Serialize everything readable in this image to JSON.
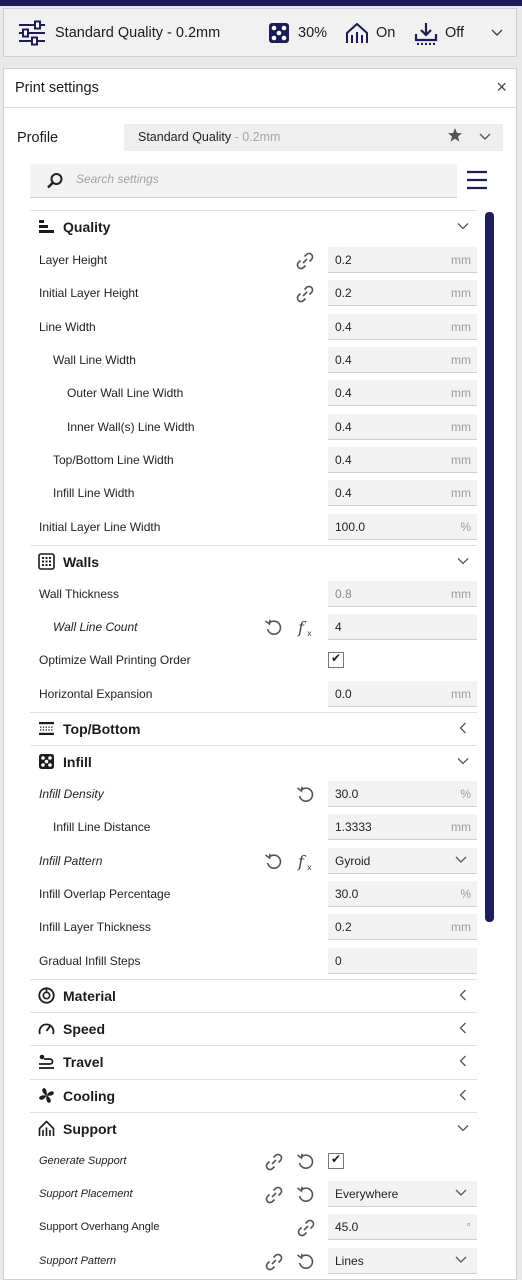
{
  "topbar": {
    "profile_label": "Standard Quality - 0.2mm",
    "infill_value": "30%",
    "support_value": "On",
    "adhesion_value": "Off"
  },
  "panel": {
    "title": "Print settings",
    "close_glyph": "×",
    "profile_label": "Profile",
    "profile_name": "Standard Quality",
    "profile_sub": " - 0.2mm",
    "search_placeholder": "Search settings"
  },
  "sections": {
    "quality": "Quality",
    "walls": "Walls",
    "topbottom": "Top/Bottom",
    "infill": "Infill",
    "material": "Material",
    "speed": "Speed",
    "travel": "Travel",
    "cooling": "Cooling",
    "support": "Support"
  },
  "settings": [
    {
      "label": "Layer Height",
      "value": "0.2",
      "unit": "mm"
    },
    {
      "label": "Initial Layer Height",
      "value": "0.2",
      "unit": "mm"
    },
    {
      "label": "Line Width",
      "value": "0.4",
      "unit": "mm"
    },
    {
      "label": "Wall Line Width",
      "value": "0.4",
      "unit": "mm"
    },
    {
      "label": "Outer Wall Line Width",
      "value": "0.4",
      "unit": "mm"
    },
    {
      "label": "Inner Wall(s) Line Width",
      "value": "0.4",
      "unit": "mm"
    },
    {
      "label": "Top/Bottom Line Width",
      "value": "0.4",
      "unit": "mm"
    },
    {
      "label": "Infill Line Width",
      "value": "0.4",
      "unit": "mm"
    },
    {
      "label": "Initial Layer Line Width",
      "value": "100.0",
      "unit": "%"
    },
    {
      "label": "Wall Thickness",
      "value": "0.8",
      "unit": "mm"
    },
    {
      "label": "Wall Line Count",
      "value": "4",
      "unit": ""
    },
    {
      "label": "Optimize Wall Printing Order",
      "value": "",
      "unit": ""
    },
    {
      "label": "Horizontal Expansion",
      "value": "0.0",
      "unit": "mm"
    },
    {
      "label": "Infill Density",
      "value": "30.0",
      "unit": "%"
    },
    {
      "label": "Infill Line Distance",
      "value": "1.3333",
      "unit": "mm"
    },
    {
      "label": "Infill Pattern",
      "value": "Gyroid",
      "unit": ""
    },
    {
      "label": "Infill Overlap Percentage",
      "value": "30.0",
      "unit": "%"
    },
    {
      "label": "Infill Layer Thickness",
      "value": "0.2",
      "unit": "mm"
    },
    {
      "label": "Gradual Infill Steps",
      "value": "0",
      "unit": ""
    },
    {
      "label": "Generate Support",
      "value": "",
      "unit": ""
    },
    {
      "label": "Support Placement",
      "value": "Everywhere",
      "unit": ""
    },
    {
      "label": "Support Overhang Angle",
      "value": "45.0",
      "unit": "°"
    },
    {
      "label": "Support Pattern",
      "value": "Lines",
      "unit": ""
    }
  ],
  "checks": {
    "optimize_wall_order": "✔",
    "generate_support": "✔"
  },
  "colors": {
    "accent": "#1e1e5e",
    "field_bg": "#f3f3f3"
  }
}
